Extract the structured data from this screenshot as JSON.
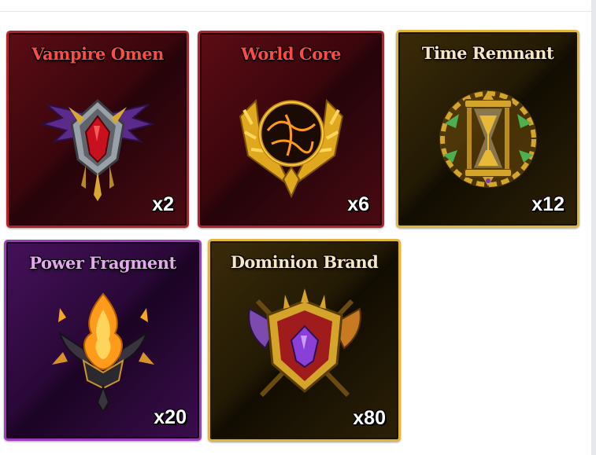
{
  "colors": {
    "red_frame": "#b3212c",
    "gold_frame": "#e0b73a",
    "purple_frame": "#9b3fb8",
    "count_text": "#ffffff"
  },
  "items": [
    {
      "name": "Vampire Omen",
      "count": "x2",
      "rarity": "red",
      "icon": "vampire-omen-icon"
    },
    {
      "name": "World Core",
      "count": "x6",
      "rarity": "red",
      "icon": "world-core-icon"
    },
    {
      "name": "Time Remnant",
      "count": "x12",
      "rarity": "gold",
      "icon": "hourglass-icon"
    },
    {
      "name": "Power Fragment",
      "count": "x20",
      "rarity": "purple",
      "icon": "flame-crest-icon"
    },
    {
      "name": "Dominion Brand",
      "count": "x80",
      "rarity": "gold",
      "icon": "shield-crest-icon"
    }
  ]
}
